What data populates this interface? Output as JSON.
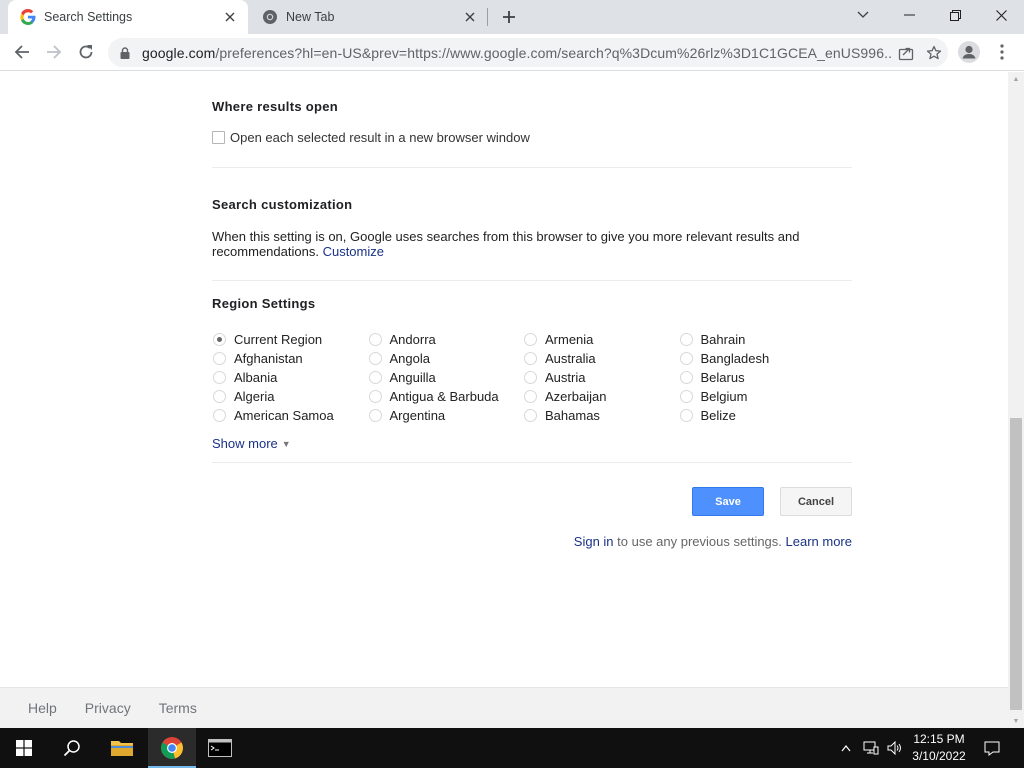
{
  "browser": {
    "tabs": [
      {
        "title": "Search Settings",
        "active": true
      },
      {
        "title": "New Tab",
        "active": false
      }
    ],
    "url_host": "google.com",
    "url_path": "/preferences?hl=en-US&prev=https://www.google.com/search?q%3Dcum%26rlz%3D1C1GCEA_enUS996..."
  },
  "page": {
    "where_results": {
      "title": "Where results open",
      "checkbox_label": "Open each selected result in a new browser window"
    },
    "customization": {
      "title": "Search customization",
      "description": "When this setting is on, Google uses searches from this browser to give you more relevant results and recommendations.",
      "link": "Customize"
    },
    "region": {
      "title": "Region Settings",
      "selected": "Current Region",
      "options": [
        "Current Region",
        "Andorra",
        "Armenia",
        "Bahrain",
        "Afghanistan",
        "Angola",
        "Australia",
        "Bangladesh",
        "Albania",
        "Anguilla",
        "Austria",
        "Belarus",
        "Algeria",
        "Antigua & Barbuda",
        "Azerbaijan",
        "Belgium",
        "American Samoa",
        "Argentina",
        "Bahamas",
        "Belize"
      ],
      "show_more": "Show more"
    },
    "buttons": {
      "save": "Save",
      "cancel": "Cancel"
    },
    "signin": {
      "link": "Sign in",
      "text": " to use any previous settings. ",
      "learn_more": "Learn more"
    }
  },
  "footer": {
    "links": [
      "Help",
      "Privacy",
      "Terms"
    ]
  },
  "taskbar": {
    "time": "12:15 PM",
    "date": "3/10/2022"
  }
}
